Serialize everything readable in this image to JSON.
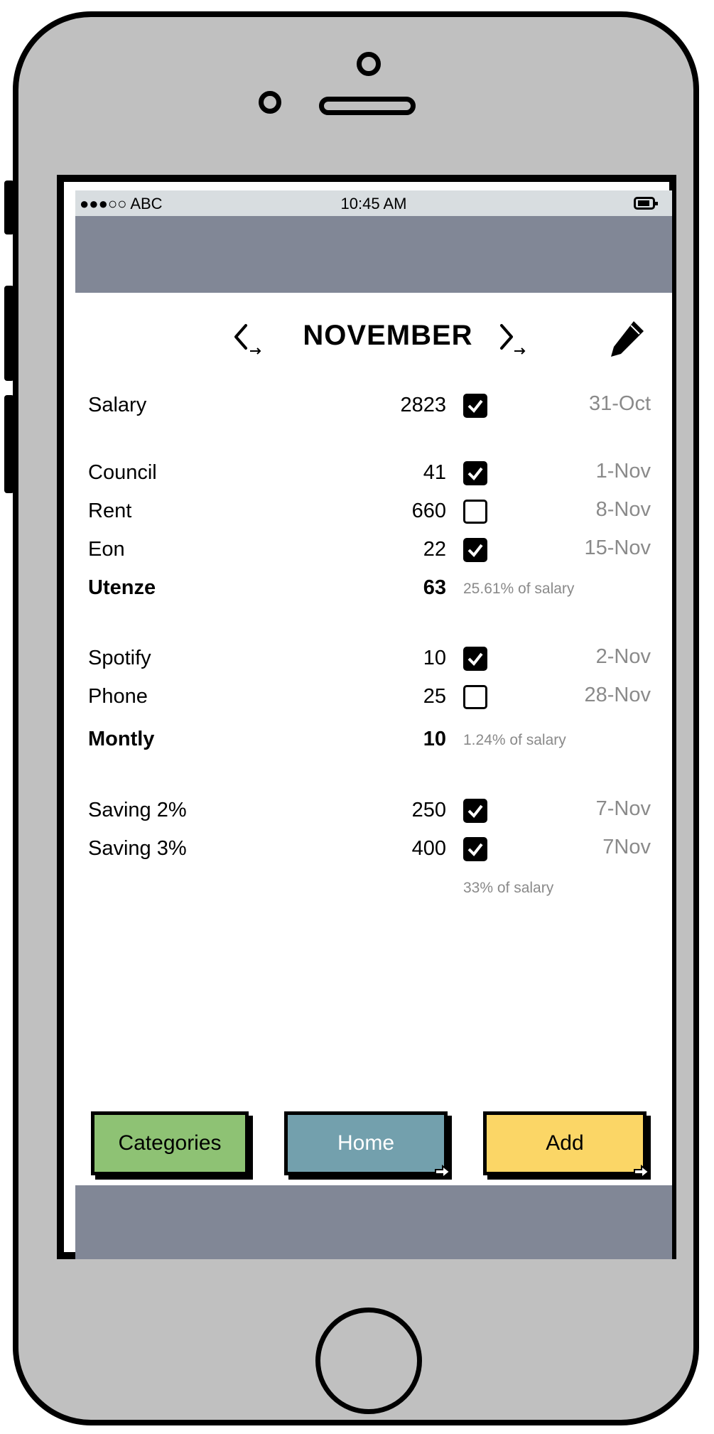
{
  "status": {
    "carrier": "●●●○○ ABC",
    "time": "10:45 AM"
  },
  "header": {
    "month": "NOVEMBER"
  },
  "items": [
    {
      "label": "Salary",
      "amount": "2823",
      "checked": true,
      "date": "31-Oct"
    },
    {
      "label": "Council",
      "amount": "41",
      "checked": true,
      "date": "1-Nov"
    },
    {
      "label": "Rent",
      "amount": "660",
      "checked": false,
      "date": "8-Nov"
    },
    {
      "label": "Eon",
      "amount": "22",
      "checked": true,
      "date": "15-Nov"
    },
    {
      "label": "Spotify",
      "amount": "10",
      "checked": true,
      "date": "2-Nov"
    },
    {
      "label": "Phone",
      "amount": "25",
      "checked": false,
      "date": "28-Nov"
    },
    {
      "label": "Saving 2%",
      "amount": "250",
      "checked": true,
      "date": "7-Nov"
    },
    {
      "label": "Saving 3%",
      "amount": "400",
      "checked": true,
      "date": "7Nov"
    }
  ],
  "totals": [
    {
      "label": "Utenze",
      "amount": "63",
      "pct": "25.61% of salary"
    },
    {
      "label": "Montly",
      "amount": "10",
      "pct": "1.24% of salary"
    }
  ],
  "savings_pct": "33% of salary",
  "buttons": {
    "categories": "Categories",
    "home": "Home",
    "add": "Add"
  },
  "colors": {
    "categories": "#8ec274",
    "home": "#73a0ad",
    "add": "#fbd666",
    "band": "#818796"
  },
  "icons": {
    "prev": "chevron-left-icon",
    "next": "chevron-right-icon",
    "edit": "pencil-icon",
    "link": "link-arrow-icon",
    "check": "checkmark-icon"
  }
}
